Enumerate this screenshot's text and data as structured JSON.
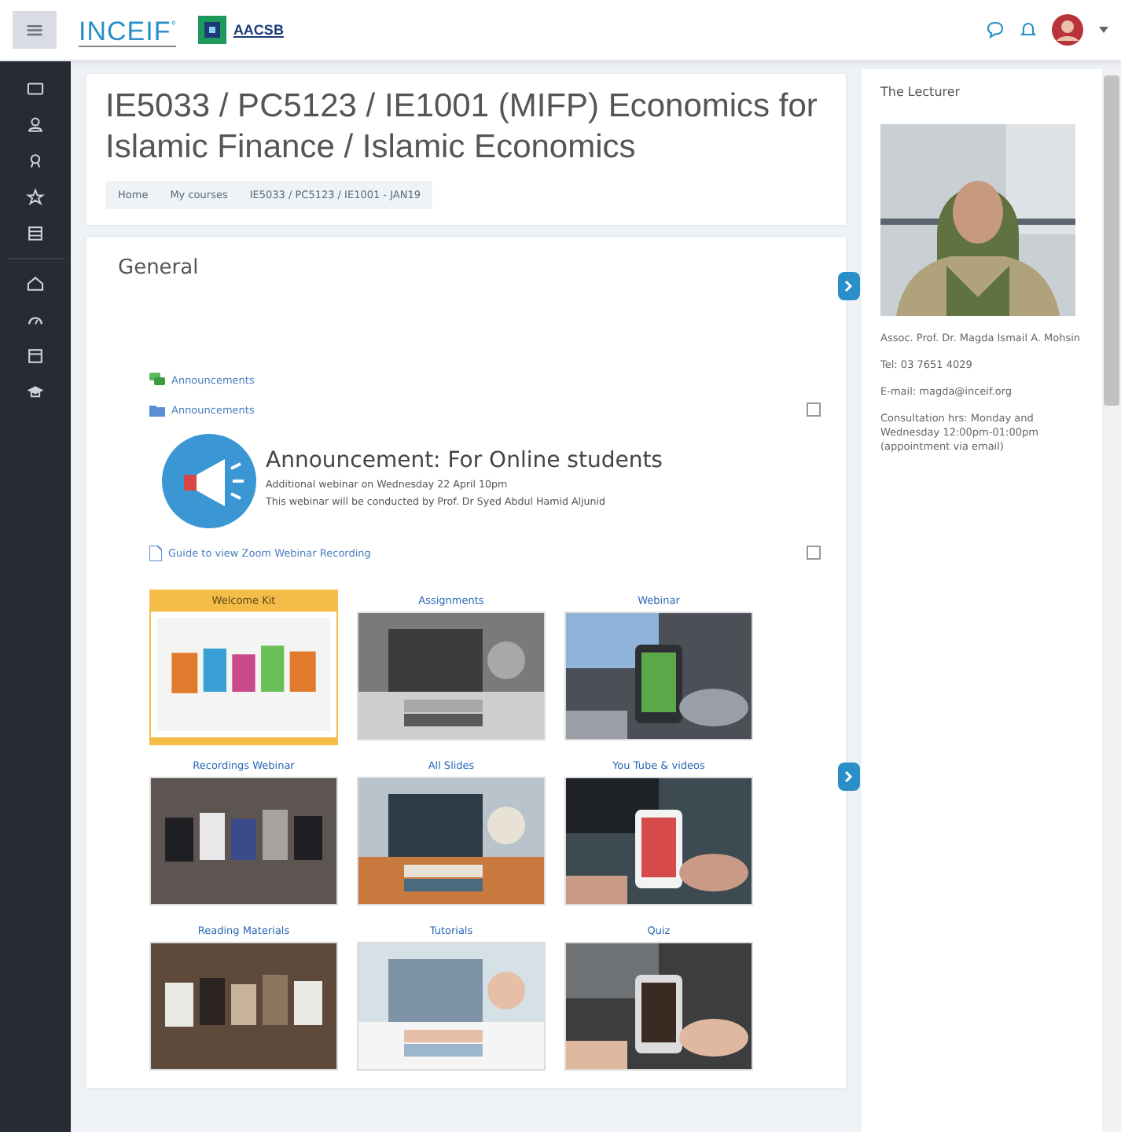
{
  "topbar": {
    "menu_button": "≡",
    "logo": "INCEIF",
    "logo_mark": "°",
    "accreditation": "AACSB"
  },
  "sidebar": {
    "groups": [
      [
        {
          "kind": "home"
        },
        {
          "kind": "user"
        },
        {
          "kind": "badge"
        },
        {
          "kind": "star"
        },
        {
          "kind": "list"
        }
      ],
      [
        {
          "kind": "house"
        },
        {
          "kind": "gauge"
        },
        {
          "kind": "calendar"
        },
        {
          "kind": "cap"
        }
      ]
    ]
  },
  "header": {
    "title": "IE5033 / PC5123 / IE1001 (MIFP) Economics for Islamic Finance / Islamic Economics",
    "breadcrumbs": [
      "Home",
      "My courses",
      "IE5033 / PC5123 / IE1001 - JAN19"
    ]
  },
  "section": {
    "title": "General",
    "activities": [
      {
        "kind": "forum",
        "label": "Announcements"
      },
      {
        "kind": "folder",
        "label": "Announcements",
        "checked": false
      },
      {
        "kind": "label",
        "heading": "Announcement: For Online students",
        "lines": [
          "Additional webinar on Wednesday 22 April 10pm",
          "This webinar will be conducted by Prof. Dr Syed Abdul Hamid Aljunid"
        ]
      },
      {
        "kind": "resource",
        "label": "Guide to view Zoom Webinar Recording",
        "checked": false
      }
    ],
    "tiles": [
      {
        "title": "Welcome Kit",
        "selected": true
      },
      {
        "title": "Assignments",
        "selected": false
      },
      {
        "title": "Webinar",
        "selected": false
      },
      {
        "title": "Recordings Webinar",
        "selected": false
      },
      {
        "title": "All Slides",
        "selected": false
      },
      {
        "title": "You Tube & videos",
        "selected": false
      },
      {
        "title": "Reading Materials",
        "selected": false
      },
      {
        "title": "Tutorials",
        "selected": false
      },
      {
        "title": "Quiz",
        "selected": false
      }
    ]
  },
  "lecturer": {
    "title": "The Lecturer",
    "paragraphs": [
      "Assoc. Prof. Dr. Magda Ismail A. Mohsin",
      "Tel: 03 7651 4029",
      "E-mail: magda@inceif.org",
      "Consultation hrs: Monday and Wednesday 12:00pm-01:00pm (appointment via email)"
    ]
  }
}
